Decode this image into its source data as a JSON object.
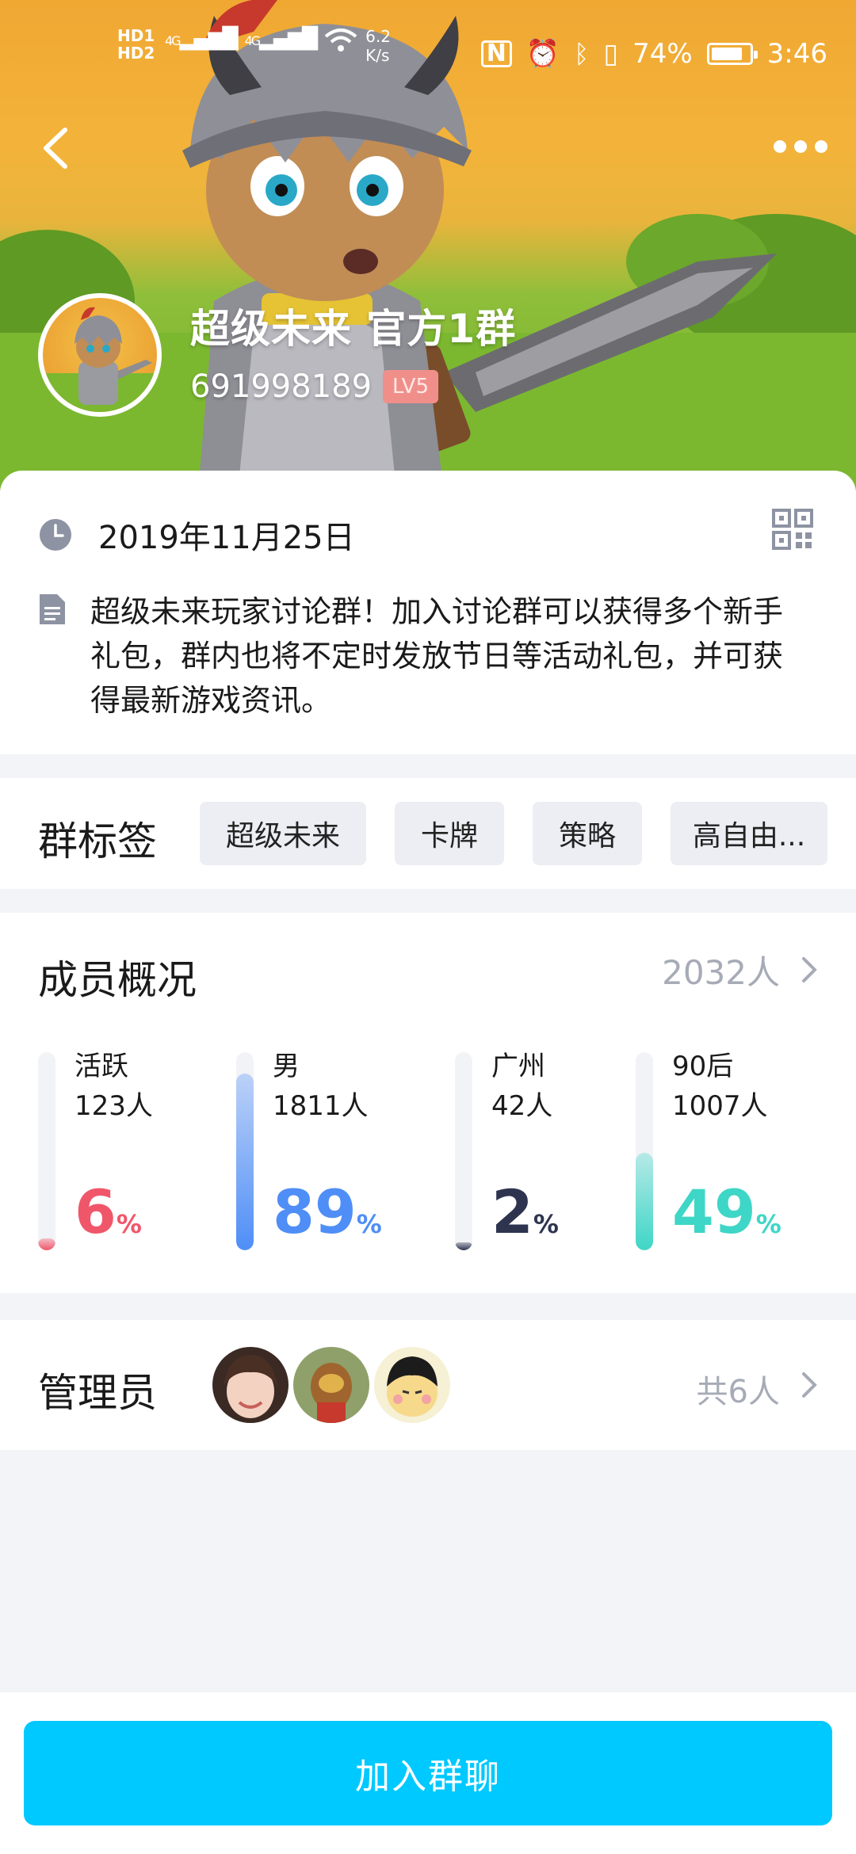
{
  "status_bar": {
    "hd1": "HD1",
    "hd2": "HD2",
    "signal1": "4G",
    "signal2": "4G",
    "speed_value": "6.2",
    "speed_unit": "K/s",
    "battery": "74%",
    "time": "3:46"
  },
  "header": {
    "group_name": "超级未来 官方1群",
    "group_id": "691998189",
    "level_badge": "LV5"
  },
  "info": {
    "date": "2019年11月25日",
    "description": "超级未来玩家讨论群！加入讨论群可以获得多个新手礼包，群内也将不定时发放节日等活动礼包，并可获得最新游戏资讯。"
  },
  "tags": {
    "title": "群标签",
    "items": [
      "超级未来",
      "卡牌",
      "策略",
      "高自由..."
    ]
  },
  "members": {
    "title": "成员概况",
    "total": "2032人",
    "stats": [
      {
        "label": "活跃",
        "count": "123人",
        "percent": "6",
        "unit": "%",
        "fraction": 0.06,
        "color": "#f0566a"
      },
      {
        "label": "男",
        "count": "1811人",
        "percent": "89",
        "unit": "%",
        "fraction": 0.89,
        "color": "#4f8ef7"
      },
      {
        "label": "广州",
        "count": "42人",
        "percent": "2",
        "unit": "%",
        "fraction": 0.02,
        "color": "#2e3450"
      },
      {
        "label": "90后",
        "count": "1007人",
        "percent": "49",
        "unit": "%",
        "fraction": 0.49,
        "color": "#3ed6c6"
      }
    ]
  },
  "admins": {
    "title": "管理员",
    "total": "共6人"
  },
  "join_button": "加入群聊",
  "colors": {
    "accent": "#00c9ff",
    "muted_text": "#a6abb6",
    "tag_bg": "#eceef3"
  }
}
